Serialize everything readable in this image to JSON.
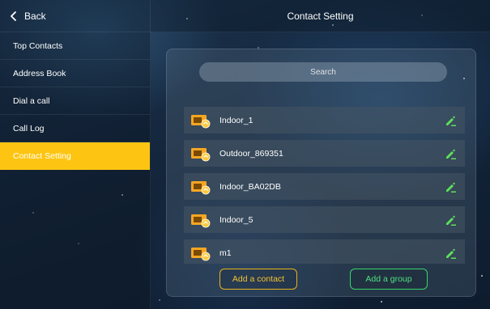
{
  "header": {
    "back_label": "Back",
    "title": "Contact Setting"
  },
  "sidebar": {
    "items": [
      {
        "label": "Top Contacts"
      },
      {
        "label": "Address Book"
      },
      {
        "label": "Dial a call"
      },
      {
        "label": "Call Log"
      },
      {
        "label": "Contact Setting",
        "active": true
      }
    ]
  },
  "search": {
    "placeholder": "Search"
  },
  "contacts": [
    {
      "name": "Indoor_1",
      "icon": "indoor-monitor-icon"
    },
    {
      "name": "Outdoor_869351",
      "icon": "indoor-monitor-icon"
    },
    {
      "name": "Indoor_BA02DB",
      "icon": "indoor-monitor-icon"
    },
    {
      "name": "Indoor_5",
      "icon": "indoor-monitor-icon"
    },
    {
      "name": "m1",
      "icon": "indoor-monitor-icon"
    }
  ],
  "actions": {
    "add_contact_label": "Add a contact",
    "add_group_label": "Add a group"
  },
  "colors": {
    "accent_yellow": "#fdc512",
    "edit_green": "#5fe05a",
    "add_group_green": "#37d46a",
    "device_icon_orange": "#f5a623"
  }
}
